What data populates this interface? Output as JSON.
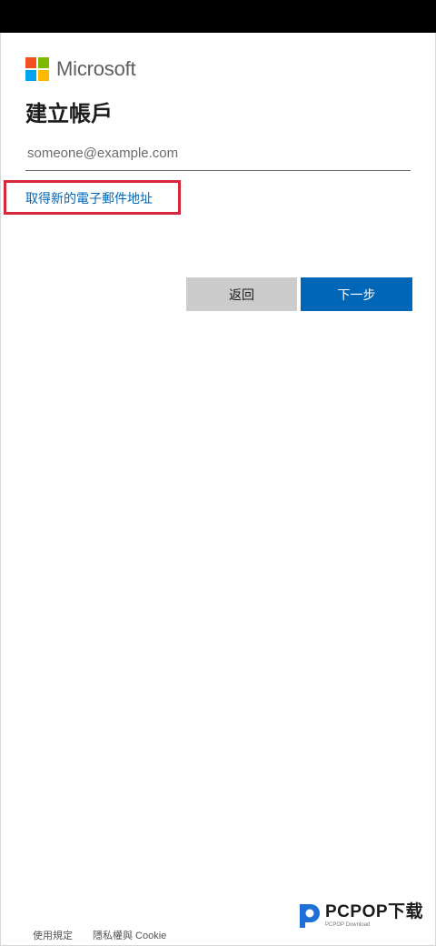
{
  "brand": {
    "name": "Microsoft",
    "logo_colors": [
      "#f25022",
      "#7fba00",
      "#00a4ef",
      "#ffb900"
    ]
  },
  "page": {
    "title": "建立帳戶"
  },
  "form": {
    "email_placeholder": "someone@example.com",
    "email_value": "",
    "new_email_link": "取得新的電子郵件地址"
  },
  "actions": {
    "back_label": "返回",
    "next_label": "下一步"
  },
  "footer": {
    "terms_label": "使用規定",
    "privacy_label": "隱私權與 Cookie"
  },
  "watermark": {
    "title": "PCPOP下载",
    "subtitle": "PCPOP Download"
  },
  "colors": {
    "accent": "#0067b8",
    "highlight": "#d7273a",
    "secondary_button": "#cccccc"
  }
}
